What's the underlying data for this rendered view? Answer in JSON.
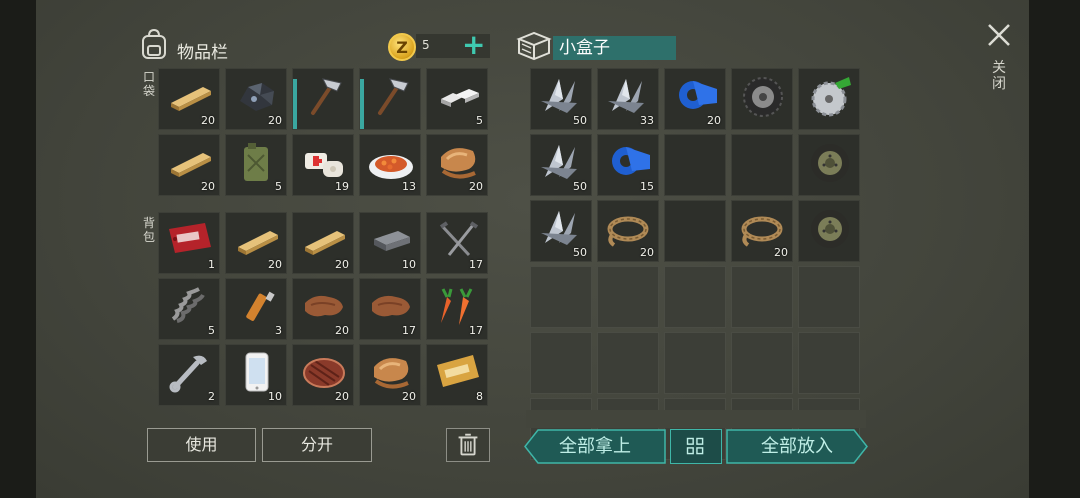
{
  "inventory": {
    "title": "物品栏",
    "coins": "5",
    "coin_symbol": "Z",
    "plus": "+",
    "pocket_label": "口袋",
    "backpack_label": "背包",
    "pocket": [
      {
        "icon": "wood-plank-icon",
        "qty": "20"
      },
      {
        "icon": "coal-ore-icon",
        "qty": "20"
      },
      {
        "icon": "hatchet-icon",
        "qty": ""
      },
      {
        "icon": "hatchet-icon",
        "qty": ""
      },
      {
        "icon": "metal-ingot-icon",
        "qty": "5"
      },
      {
        "icon": "wood-plank-icon",
        "qty": "20"
      },
      {
        "icon": "jerrycan-icon",
        "qty": "5"
      },
      {
        "icon": "bandage-icon",
        "qty": "19"
      },
      {
        "icon": "cooked-dish-icon",
        "qty": "13"
      },
      {
        "icon": "raw-meat-bone-icon",
        "qty": "20"
      }
    ],
    "backpack": [
      {
        "icon": "coupon-red-icon",
        "qty": "1"
      },
      {
        "icon": "wood-plank-icon",
        "qty": "20"
      },
      {
        "icon": "wood-plank-icon",
        "qty": "20"
      },
      {
        "icon": "iron-ingot-icon",
        "qty": "10"
      },
      {
        "icon": "nails-icon",
        "qty": "17"
      },
      {
        "icon": "spring-icon",
        "qty": "5"
      },
      {
        "icon": "usb-lighter-icon",
        "qty": "3"
      },
      {
        "icon": "leather-icon",
        "qty": "20"
      },
      {
        "icon": "leather-icon",
        "qty": "17"
      },
      {
        "icon": "carrot-icon",
        "qty": "17"
      },
      {
        "icon": "wrench-icon",
        "qty": "2"
      },
      {
        "icon": "smartphone-icon",
        "qty": "10"
      },
      {
        "icon": "steak-icon",
        "qty": "20"
      },
      {
        "icon": "raw-meat-bone-icon",
        "qty": "20"
      },
      {
        "icon": "coupon-gold-icon",
        "qty": "8"
      }
    ],
    "use_button": "使用",
    "split_button": "分开"
  },
  "box": {
    "title": "小盒子",
    "slots": [
      {
        "icon": "scrap-metal-icon",
        "qty": "50"
      },
      {
        "icon": "scrap-metal-icon",
        "qty": "33"
      },
      {
        "icon": "duct-tape-icon",
        "qty": "20"
      },
      {
        "icon": "tire-icon",
        "qty": ""
      },
      {
        "icon": "saw-blade-icon",
        "qty": ""
      },
      {
        "icon": "scrap-metal-icon",
        "qty": "50"
      },
      {
        "icon": "duct-tape-icon",
        "qty": "15"
      },
      {
        "icon": "",
        "qty": ""
      },
      {
        "icon": "",
        "qty": ""
      },
      {
        "icon": "wheel-icon",
        "qty": ""
      },
      {
        "icon": "scrap-metal-icon",
        "qty": "50"
      },
      {
        "icon": "rope-icon",
        "qty": "20"
      },
      {
        "icon": "",
        "qty": ""
      },
      {
        "icon": "rope-icon",
        "qty": "20"
      },
      {
        "icon": "wheel-icon",
        "qty": ""
      }
    ],
    "take_all_button": "全部拿上",
    "put_all_button": "全部放入"
  },
  "close_label": "关闭",
  "colors": {
    "accent": "#3fb6a8",
    "box_title_bg": "#2e706b",
    "panel_bg": "#45473e"
  }
}
